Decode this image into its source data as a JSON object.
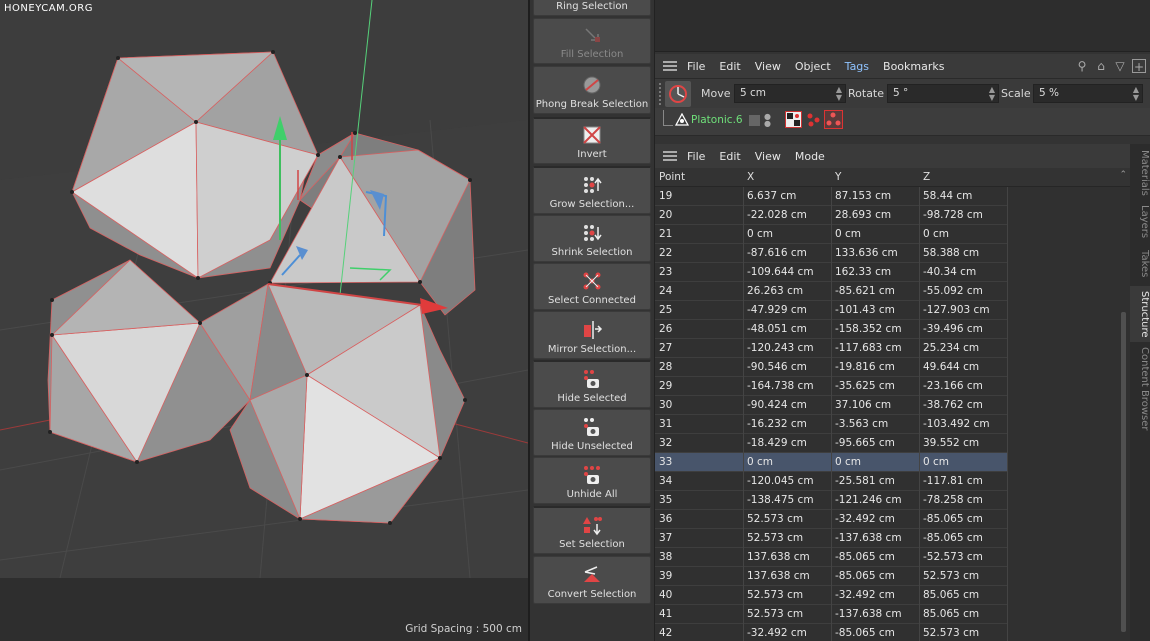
{
  "viewport": {
    "watermark": "HONEYCAM.ORG",
    "grid_spacing": "Grid Spacing : 500 cm"
  },
  "palette": {
    "buttons": [
      {
        "label": "Ring Selection",
        "icon": "ring-selection-icon",
        "dim": false
      },
      {
        "label": "Fill Selection",
        "icon": "fill-selection-icon",
        "dim": true
      },
      {
        "label": "Phong Break Selection",
        "icon": "phong-break-icon",
        "dim": false
      },
      {
        "label": "Invert",
        "icon": "invert-icon",
        "dim": false
      },
      {
        "label": "Grow Selection...",
        "icon": "grow-selection-icon",
        "dim": false
      },
      {
        "label": "Shrink Selection",
        "icon": "shrink-selection-icon",
        "dim": false
      },
      {
        "label": "Select Connected",
        "icon": "select-connected-icon",
        "dim": false
      },
      {
        "label": "Mirror Selection...",
        "icon": "mirror-selection-icon",
        "dim": false
      },
      {
        "label": "Hide Selected",
        "icon": "hide-selected-icon",
        "dim": false
      },
      {
        "label": "Hide Unselected",
        "icon": "hide-unselected-icon",
        "dim": false
      },
      {
        "label": "Unhide All",
        "icon": "unhide-all-icon",
        "dim": false
      },
      {
        "label": "Set Selection",
        "icon": "set-selection-icon",
        "dim": false
      },
      {
        "label": "Convert Selection",
        "icon": "convert-selection-icon",
        "dim": false
      }
    ]
  },
  "object_manager": {
    "menu": [
      "File",
      "Edit",
      "View",
      "Object",
      "Tags",
      "Bookmarks"
    ],
    "active_menu": "Tags",
    "attributes": {
      "move_label": "Move",
      "move_value": "5 cm",
      "rotate_label": "Rotate",
      "rotate_value": "5 °",
      "scale_label": "Scale",
      "scale_value": "5 %"
    },
    "object_name": "Platonic.6"
  },
  "structure": {
    "menu": [
      "File",
      "Edit",
      "View",
      "Mode"
    ],
    "columns": [
      "Point",
      "X",
      "Y",
      "Z"
    ],
    "selected_point": "33",
    "rows": [
      [
        "19",
        "6.637 cm",
        "87.153 cm",
        "58.44 cm"
      ],
      [
        "20",
        "-22.028 cm",
        "28.693 cm",
        "-98.728 cm"
      ],
      [
        "21",
        "0 cm",
        "0 cm",
        "0 cm"
      ],
      [
        "22",
        "-87.616 cm",
        "133.636 cm",
        "58.388 cm"
      ],
      [
        "23",
        "-109.644 cm",
        "162.33 cm",
        "-40.34 cm"
      ],
      [
        "24",
        "26.263 cm",
        "-85.621 cm",
        "-55.092 cm"
      ],
      [
        "25",
        "-47.929 cm",
        "-101.43 cm",
        "-127.903 cm"
      ],
      [
        "26",
        "-48.051 cm",
        "-158.352 cm",
        "-39.496 cm"
      ],
      [
        "27",
        "-120.243 cm",
        "-117.683 cm",
        "25.234 cm"
      ],
      [
        "28",
        "-90.546 cm",
        "-19.816 cm",
        "49.644 cm"
      ],
      [
        "29",
        "-164.738 cm",
        "-35.625 cm",
        "-23.166 cm"
      ],
      [
        "30",
        "-90.424 cm",
        "37.106 cm",
        "-38.762 cm"
      ],
      [
        "31",
        "-16.232 cm",
        "-3.563 cm",
        "-103.492 cm"
      ],
      [
        "32",
        "-18.429 cm",
        "-95.665 cm",
        "39.552 cm"
      ],
      [
        "33",
        "0 cm",
        "0 cm",
        "0 cm"
      ],
      [
        "34",
        "-120.045 cm",
        "-25.581 cm",
        "-117.81 cm"
      ],
      [
        "35",
        "-138.475 cm",
        "-121.246 cm",
        "-78.258 cm"
      ],
      [
        "36",
        "52.573 cm",
        "-32.492 cm",
        "-85.065 cm"
      ],
      [
        "37",
        "52.573 cm",
        "-137.638 cm",
        "-85.065 cm"
      ],
      [
        "38",
        "137.638 cm",
        "-85.065 cm",
        "-52.573 cm"
      ],
      [
        "39",
        "137.638 cm",
        "-85.065 cm",
        "52.573 cm"
      ],
      [
        "40",
        "52.573 cm",
        "-32.492 cm",
        "85.065 cm"
      ],
      [
        "41",
        "52.573 cm",
        "-137.638 cm",
        "85.065 cm"
      ],
      [
        "42",
        "-32.492 cm",
        "-85.065 cm",
        "52.573 cm"
      ]
    ]
  },
  "side_tabs": [
    "Materials",
    "Layers",
    "Takes",
    "Structure",
    "Content Browser"
  ],
  "active_side_tab": "Structure",
  "colors": {
    "accent": "#8fc3ff",
    "object_green": "#6fe07a",
    "selection_row": "#48556b",
    "edge_red": "#e05050"
  }
}
